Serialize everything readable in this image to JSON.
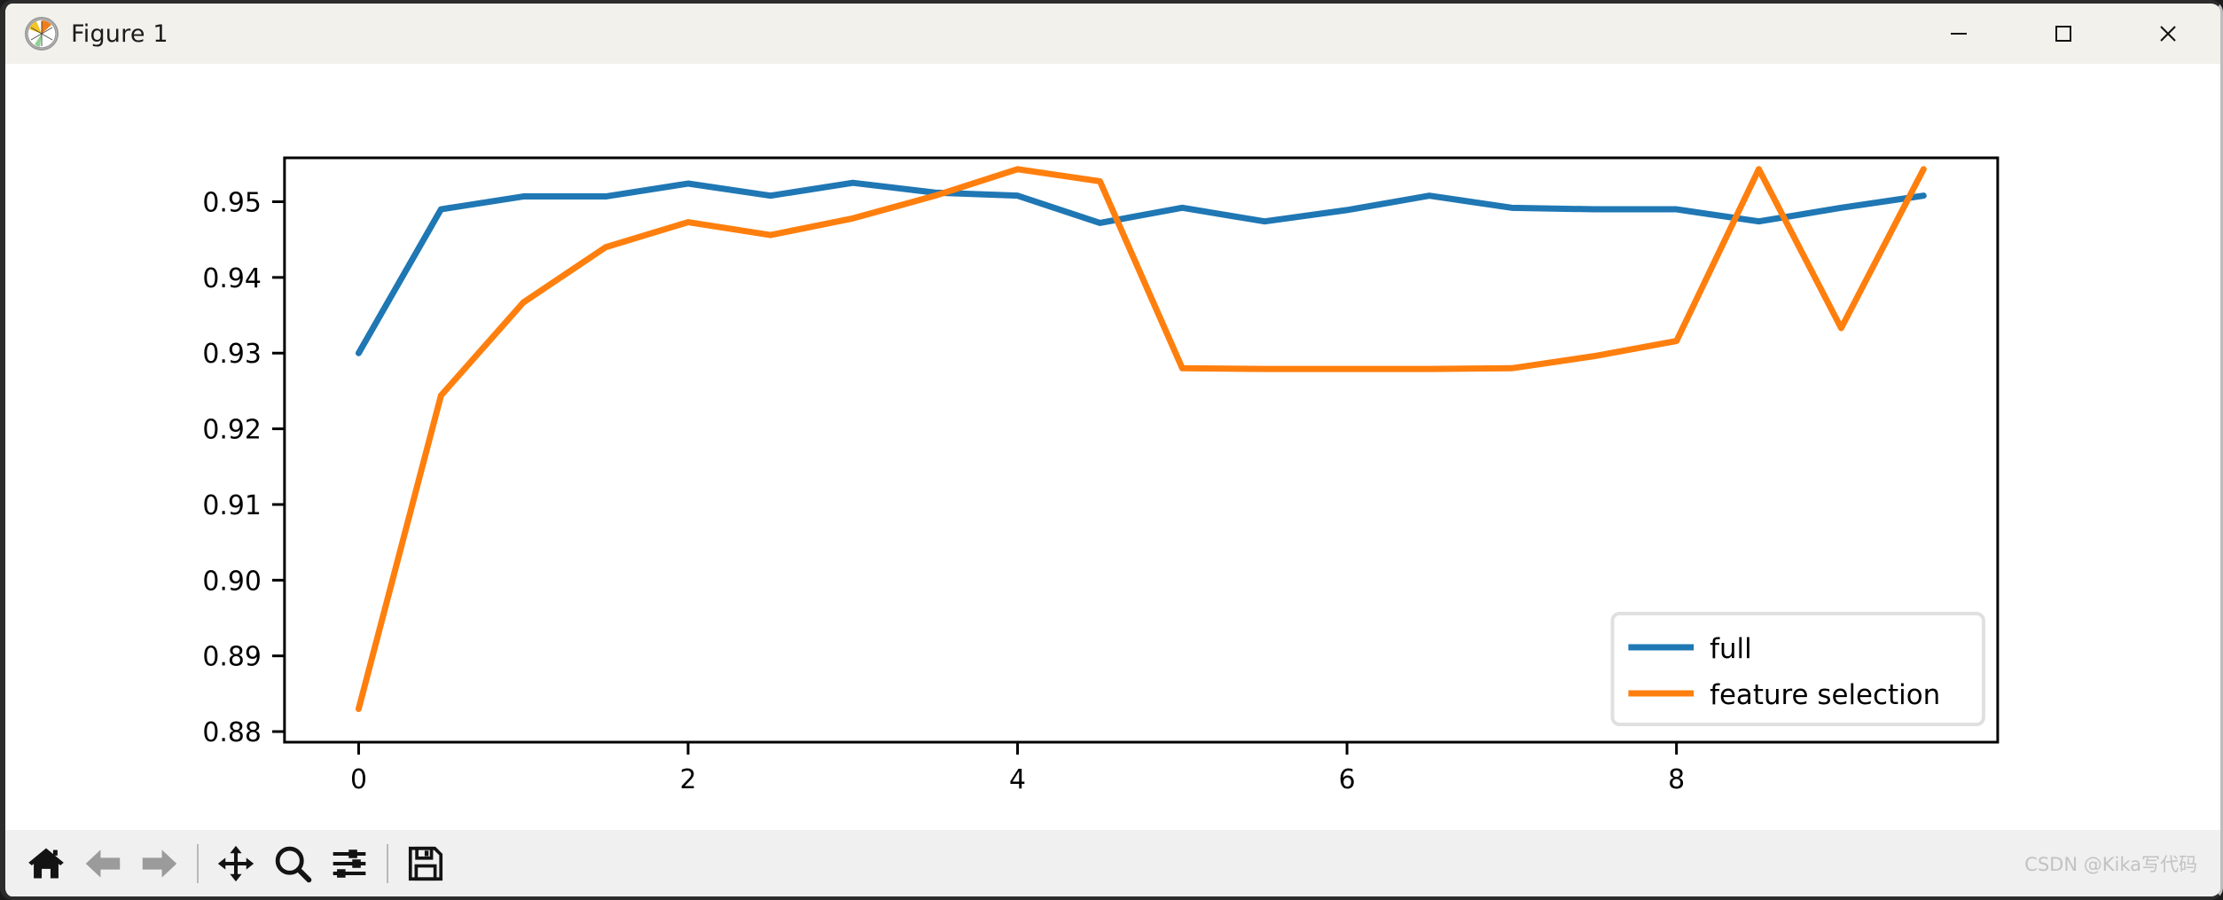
{
  "window": {
    "title": "Figure 1",
    "logo_icon": "matplotlib-logo-icon",
    "minimize_label": "─",
    "maximize_label": "□",
    "close_label": "✕"
  },
  "toolbar": {
    "buttons": [
      {
        "name": "home-button",
        "icon": "home-icon",
        "tooltip": "Reset original view",
        "enabled": true
      },
      {
        "name": "back-button",
        "icon": "arrow-left-icon",
        "tooltip": "Back to previous view",
        "enabled": false
      },
      {
        "name": "forward-button",
        "icon": "arrow-right-icon",
        "tooltip": "Forward to next view",
        "enabled": false
      },
      {
        "name": "pan-button",
        "icon": "move-arrows-icon",
        "tooltip": "Pan axes with left mouse, zoom with right",
        "enabled": true
      },
      {
        "name": "zoom-button",
        "icon": "magnifier-icon",
        "tooltip": "Zoom to rectangle",
        "enabled": true
      },
      {
        "name": "configure-subplots-button",
        "icon": "sliders-icon",
        "tooltip": "Configure subplots",
        "enabled": true
      },
      {
        "name": "save-button",
        "icon": "floppy-disk-icon",
        "tooltip": "Save the figure",
        "enabled": true
      }
    ],
    "watermark": "CSDN @Kika写代码"
  },
  "chart_data": {
    "type": "line",
    "title": "",
    "xlabel": "",
    "ylabel": "",
    "xlim": [
      -0.45,
      9.95
    ],
    "ylim": [
      0.8786,
      0.9558
    ],
    "xticks": [
      0,
      2,
      4,
      6,
      8
    ],
    "xtick_labels": [
      "0",
      "2",
      "4",
      "6",
      "8"
    ],
    "yticks": [
      0.88,
      0.89,
      0.9,
      0.91,
      0.92,
      0.93,
      0.94,
      0.95
    ],
    "ytick_labels": [
      "0.88",
      "0.89",
      "0.90",
      "0.91",
      "0.92",
      "0.93",
      "0.94",
      "0.95"
    ],
    "grid": false,
    "legend_position": "lower right",
    "x": [
      0,
      0.5,
      1,
      1.5,
      2,
      2.5,
      3,
      3.5,
      4,
      4.5,
      5,
      5.5,
      6,
      6.5,
      7,
      7.5,
      8,
      8.5,
      9,
      9.5
    ],
    "series": [
      {
        "name": "full",
        "color": "#1f77b4",
        "values": [
          0.93,
          0.949,
          0.9507,
          0.9507,
          0.9524,
          0.9508,
          0.9525,
          0.9512,
          0.9508,
          0.9472,
          0.9492,
          0.9474,
          0.9489,
          0.9508,
          0.9492,
          0.949,
          0.949,
          0.9474,
          0.9492,
          0.9508
        ]
      },
      {
        "name": "feature selection",
        "color": "#ff7f0e",
        "values": [
          0.883,
          0.9244,
          0.9367,
          0.944,
          0.9473,
          0.9456,
          0.9478,
          0.9508,
          0.9543,
          0.9527,
          0.928,
          0.9279,
          0.9279,
          0.9279,
          0.928,
          0.9296,
          0.9316,
          0.9543,
          0.9333,
          0.9543
        ]
      }
    ],
    "legend": [
      {
        "label": "full",
        "color": "#1f77b4"
      },
      {
        "label": "feature selection",
        "color": "#ff7f0e"
      }
    ]
  }
}
